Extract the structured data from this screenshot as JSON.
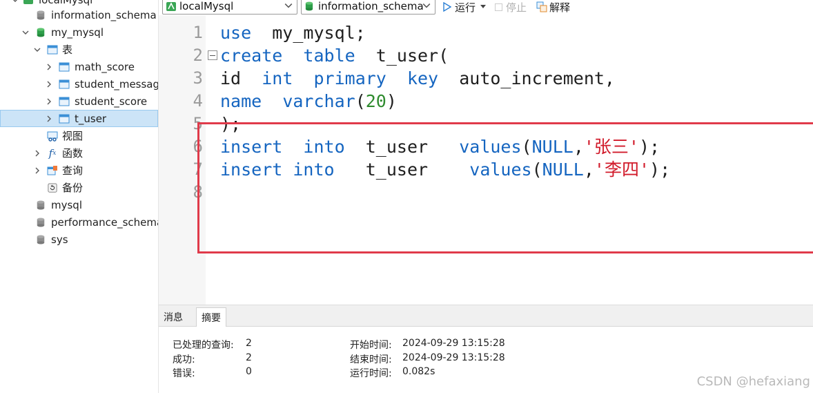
{
  "sidebar": {
    "connection_partial": "localMysql",
    "databases_top": [
      "information_schema"
    ],
    "active_db": "my_mysql",
    "tables_folder": "表",
    "tables": [
      "math_score",
      "student_messag",
      "student_score",
      "t_user"
    ],
    "views": "视图",
    "functions": "函数",
    "queries": "查询",
    "backups": "备份",
    "databases_bottom": [
      "mysql",
      "performance_schema",
      "sys"
    ]
  },
  "toolbar": {
    "connection": "localMysql",
    "database": "information_schema",
    "run": "运行",
    "stop": "停止",
    "explain": "解释"
  },
  "editor": {
    "line_numbers": [
      "1",
      "2",
      "3",
      "4",
      "5",
      "6",
      "7",
      "8"
    ],
    "l1": [
      "use",
      "  my_mysql;"
    ],
    "l2": [
      "create",
      "  ",
      "table",
      "  t_user("
    ],
    "l3": [
      "id",
      "  ",
      "int",
      "  ",
      "primary",
      "  ",
      "key",
      "  auto_increment,"
    ],
    "l4": [
      "name",
      "  ",
      "varchar",
      "(",
      "20",
      ")"
    ],
    "l5": [
      ");"
    ],
    "l6": [
      "insert",
      "  ",
      "into",
      "  t_user   ",
      "values",
      "(",
      "NULL",
      ",",
      "'张三'",
      ");"
    ],
    "l7": [
      "insert",
      " ",
      "into",
      "   t_user    ",
      "values",
      "(",
      "NULL",
      ",",
      "'李四'",
      ");"
    ]
  },
  "bottom": {
    "tabs": [
      "消息",
      "摘要"
    ],
    "active_tab": "摘要",
    "summary": {
      "processed_label": "已处理的查询:",
      "processed_value": "2",
      "success_label": "成功:",
      "success_value": "2",
      "error_label": "错误:",
      "error_value": "0",
      "start_label": "开始时间:",
      "start_value": "2024-09-29 13:15:28",
      "end_label": "结束时间:",
      "end_value": "2024-09-29 13:15:28",
      "elapsed_label": "运行时间:",
      "elapsed_value": "0.082s"
    }
  },
  "watermark": "CSDN @hefaxiang",
  "colors": {
    "keyword": "#1565c0",
    "number": "#2e8b2e",
    "string": "#d11a2a",
    "highlight_box": "#e03a4a",
    "selection": "#cce4f7"
  }
}
